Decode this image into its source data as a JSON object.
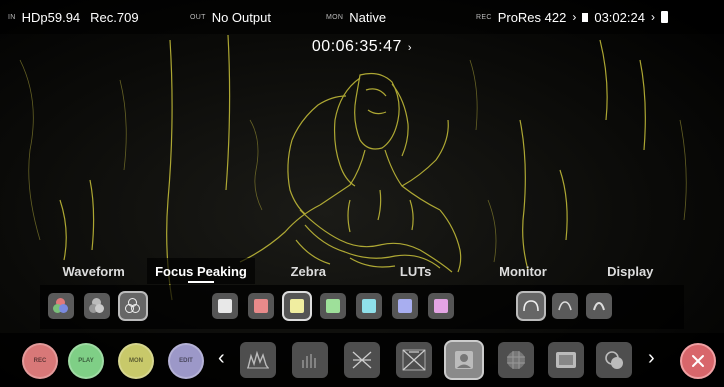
{
  "status_bar": {
    "input_tag": "IN",
    "input_format": "HDp59.94",
    "color_space": "Rec.709",
    "output_tag": "OUT",
    "output_value": "No Output",
    "monitor_tag": "MON",
    "monitor_value": "Native",
    "rec_tag": "REC",
    "codec": "ProRes 422",
    "remaining_time": "03:02:24"
  },
  "timecode": "00:06:35:47",
  "tabs": [
    {
      "label": "Waveform"
    },
    {
      "label": "Focus Peaking"
    },
    {
      "label": "Zebra"
    },
    {
      "label": "LUTs"
    },
    {
      "label": "Monitor"
    },
    {
      "label": "Display"
    }
  ],
  "active_tab": "Focus Peaking",
  "peaking_modes": [
    "color-overlay",
    "gray-overlay",
    "outline-only"
  ],
  "selected_peaking_mode": "outline-only",
  "peaking_colors": [
    {
      "name": "white",
      "color": "#e8e8e8"
    },
    {
      "name": "red",
      "color": "#e88a8a"
    },
    {
      "name": "yellow",
      "color": "#f0eea0"
    },
    {
      "name": "green",
      "color": "#9ee09a"
    },
    {
      "name": "cyan",
      "color": "#8fe0ea"
    },
    {
      "name": "blue",
      "color": "#a8aef0"
    },
    {
      "name": "magenta",
      "color": "#e4a4e4"
    }
  ],
  "selected_peaking_color": "yellow",
  "sensitivity_levels": [
    "low",
    "medium",
    "high"
  ],
  "selected_sensitivity": "low",
  "transport": [
    {
      "label": "REC",
      "color": "#d87878"
    },
    {
      "label": "PLAY",
      "color": "#7fcf86"
    },
    {
      "label": "MON",
      "color": "#c8c96a"
    },
    {
      "label": "EDIT",
      "color": "#9c98c8"
    }
  ],
  "tools": [
    "waveform-tool",
    "histogram-tool",
    "focus-peaking-tool",
    "false-color-tool",
    "zebra-tool",
    "grid-tool",
    "frame-guides-tool",
    "anamorphic-tool"
  ],
  "selected_tool": "zebra-tool",
  "accent_color": "#d8d23a",
  "close_color": "#d8666b"
}
